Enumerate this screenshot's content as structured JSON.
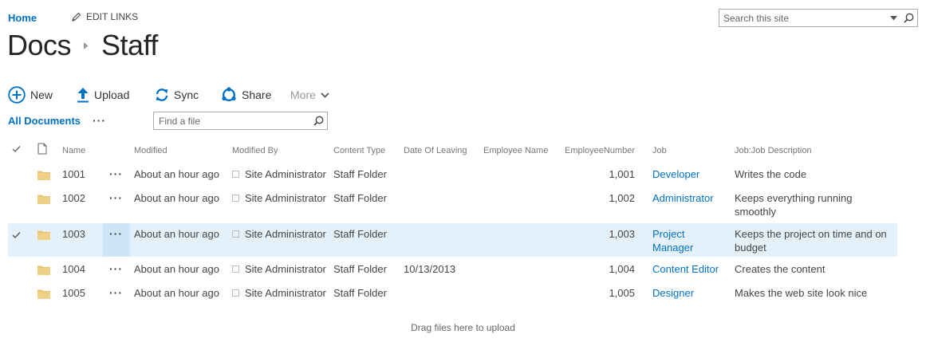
{
  "topnav": {
    "home": "Home",
    "edit_links": "EDIT LINKS"
  },
  "search": {
    "placeholder": "Search this site"
  },
  "breadcrumb": {
    "parent": "Docs",
    "current": "Staff"
  },
  "commands": {
    "new": "New",
    "upload": "Upload",
    "sync": "Sync",
    "share": "Share",
    "more": "More"
  },
  "views": {
    "all_documents": "All Documents",
    "find_placeholder": "Find a file"
  },
  "columns": {
    "name": "Name",
    "modified": "Modified",
    "modified_by": "Modified By",
    "content_type": "Content Type",
    "date_of_leaving": "Date Of Leaving",
    "employee_name": "Employee Name",
    "employee_number": "EmployeeNumber",
    "job": "Job",
    "job_description": "Job:Job Description"
  },
  "rows": [
    {
      "name": "1001",
      "modified": "About an hour ago",
      "modified_by": "Site Administrator",
      "content_type": "Staff Folder",
      "date_of_leaving": "",
      "employee_name": "",
      "employee_number": "1,001",
      "job": "Developer",
      "job_description": "Writes the code",
      "selected": false
    },
    {
      "name": "1002",
      "modified": "About an hour ago",
      "modified_by": "Site Administrator",
      "content_type": "Staff Folder",
      "date_of_leaving": "",
      "employee_name": "",
      "employee_number": "1,002",
      "job": "Administrator",
      "job_description": "Keeps everything running smoothly",
      "selected": false
    },
    {
      "name": "1003",
      "modified": "About an hour ago",
      "modified_by": "Site Administrator",
      "content_type": "Staff Folder",
      "date_of_leaving": "",
      "employee_name": "",
      "employee_number": "1,003",
      "job": "Project Manager",
      "job_description": "Keeps the project on time and on budget",
      "selected": true
    },
    {
      "name": "1004",
      "modified": "About an hour ago",
      "modified_by": "Site Administrator",
      "content_type": "Staff Folder",
      "date_of_leaving": "10/13/2013",
      "employee_name": "",
      "employee_number": "1,004",
      "job": "Content Editor",
      "job_description": "Creates the content",
      "selected": false
    },
    {
      "name": "1005",
      "modified": "About an hour ago",
      "modified_by": "Site Administrator",
      "content_type": "Staff Folder",
      "date_of_leaving": "",
      "employee_name": "",
      "employee_number": "1,005",
      "job": "Designer",
      "job_description": "Makes the web site look nice",
      "selected": false
    }
  ],
  "footer": {
    "drag_note": "Drag files here to upload"
  },
  "colors": {
    "accent": "#0072c6",
    "selected_row": "#e5f1fa",
    "folder": "#e9c26f"
  },
  "icons": [
    "pencil-icon",
    "search-icon",
    "dropdown-arrow-icon",
    "chevron-right-icon",
    "plus-circle-icon",
    "upload-arrow-icon",
    "sync-icon",
    "share-icon",
    "chevron-down-icon",
    "checkmark-icon",
    "document-icon",
    "folder-icon",
    "ellipsis-icon"
  ]
}
